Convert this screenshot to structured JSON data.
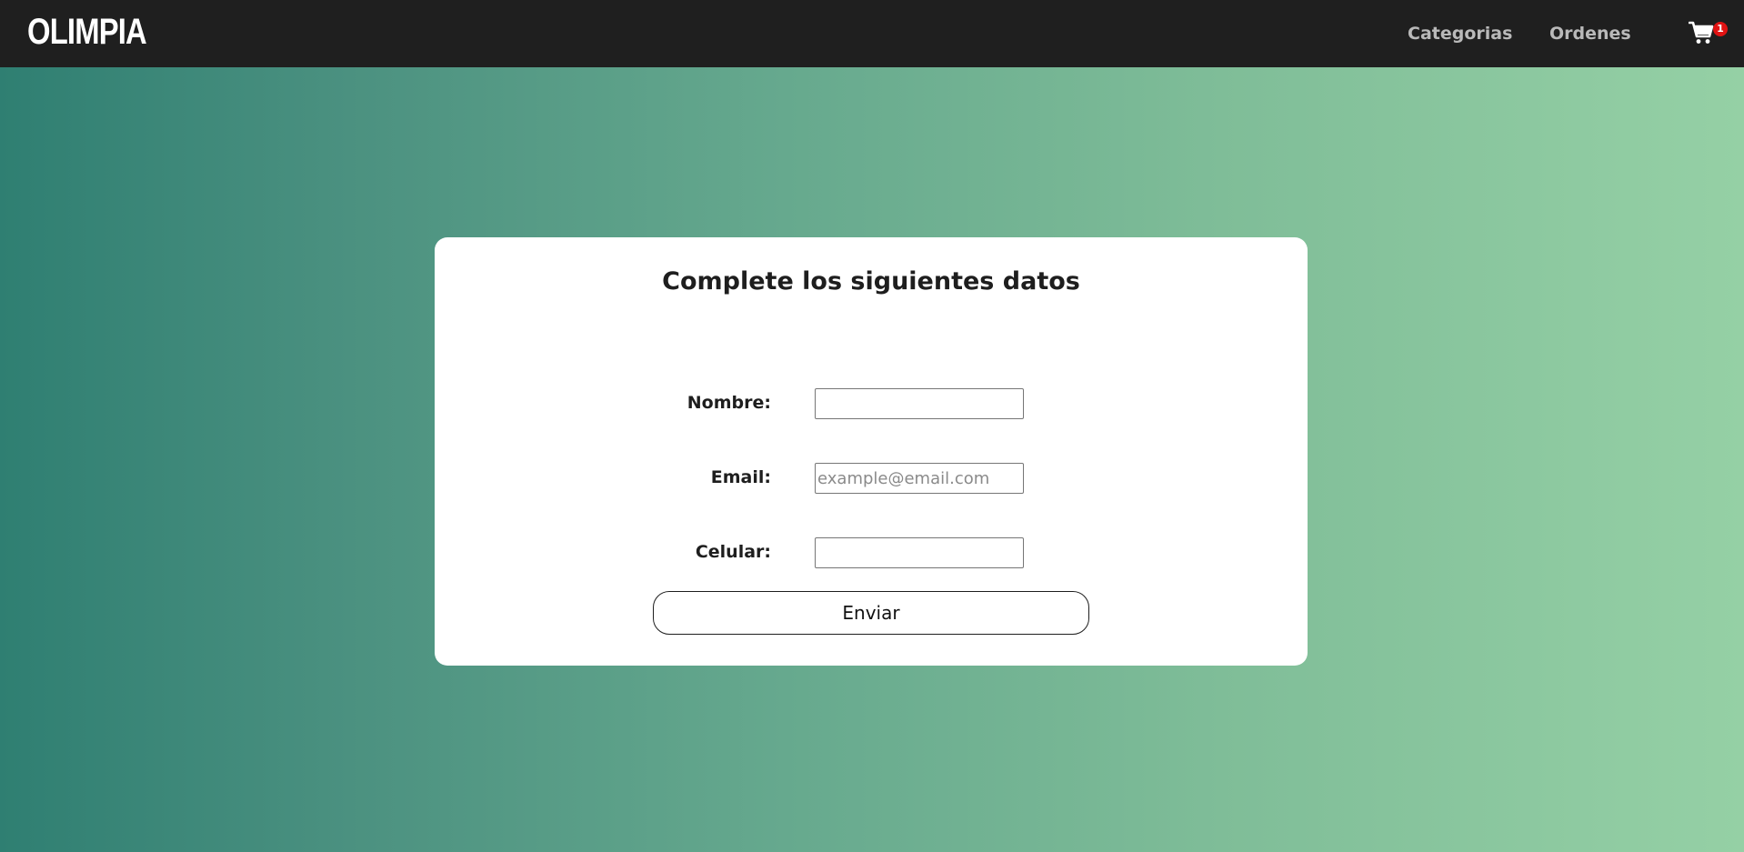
{
  "navbar": {
    "brand": "OLIMPIA",
    "links": [
      {
        "label": "Categorias"
      },
      {
        "label": "Ordenes"
      }
    ],
    "cart": {
      "icon": "shopping-cart-icon",
      "badge_count": "1",
      "badge_color": "#e01313"
    }
  },
  "form": {
    "title": "Complete los siguientes datos",
    "fields": [
      {
        "label": "Nombre:",
        "value": "",
        "placeholder": ""
      },
      {
        "label": "Email:",
        "value": "",
        "placeholder": "example@email.com"
      },
      {
        "label": "Celular:",
        "value": "",
        "placeholder": ""
      }
    ],
    "submit_label": "Enviar"
  },
  "colors": {
    "navbar_bg": "#1f1f1f",
    "gradient_start": "#2f7f72",
    "gradient_end": "#95d0a5",
    "card_bg": "#ffffff"
  }
}
